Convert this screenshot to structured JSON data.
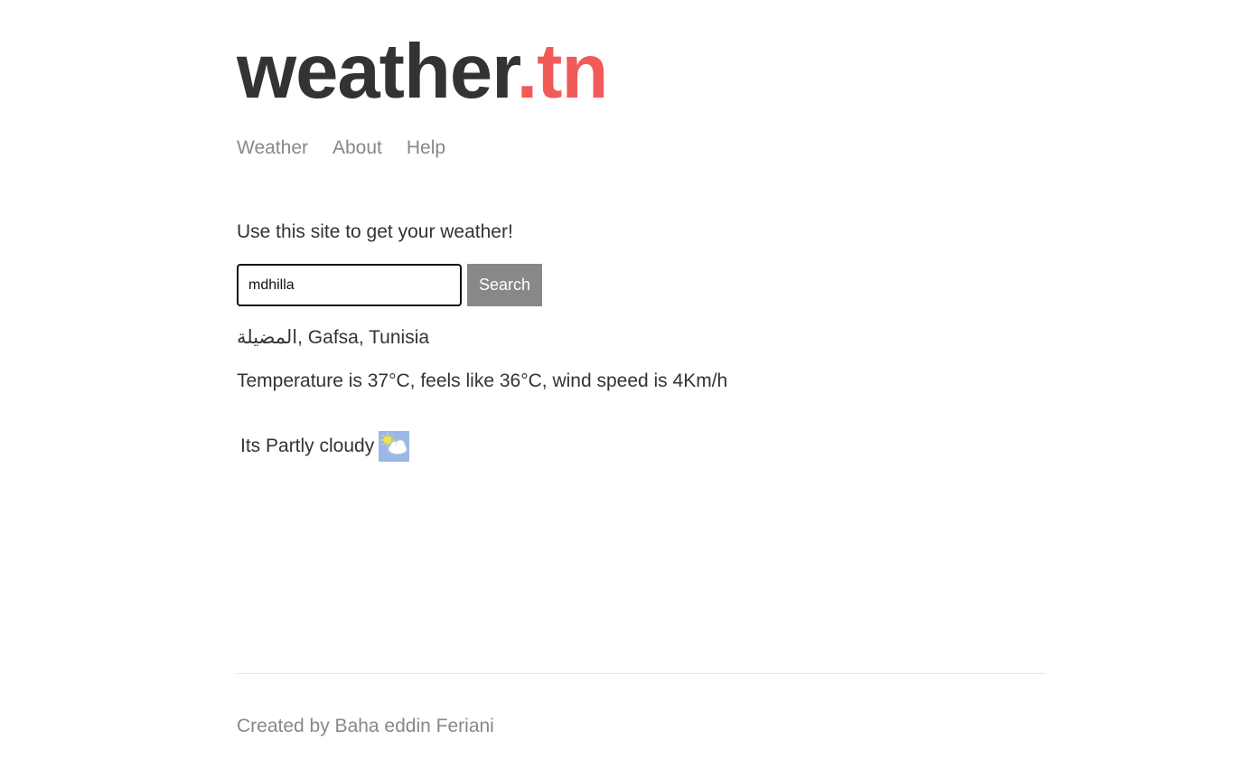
{
  "brand": {
    "name": "weather",
    "suffix": ".tn"
  },
  "nav": {
    "items": [
      {
        "label": "Weather"
      },
      {
        "label": "About"
      },
      {
        "label": "Help"
      }
    ]
  },
  "main": {
    "intro": "Use this site to get your weather!",
    "search": {
      "value": "mdhilla",
      "button_label": "Search"
    },
    "location": "المضيلة, Gafsa, Tunisia",
    "forecast": "Temperature is 37°C, feels like 36°C, wind speed is 4Km/h",
    "condition": "Its Partly cloudy",
    "condition_icon": "partly-cloudy-icon"
  },
  "footer": {
    "credit": "Created by Baha eddin Feriani"
  },
  "colors": {
    "text": "#333333",
    "muted": "#888888",
    "accent": "#f25a5a",
    "button": "#888888"
  }
}
